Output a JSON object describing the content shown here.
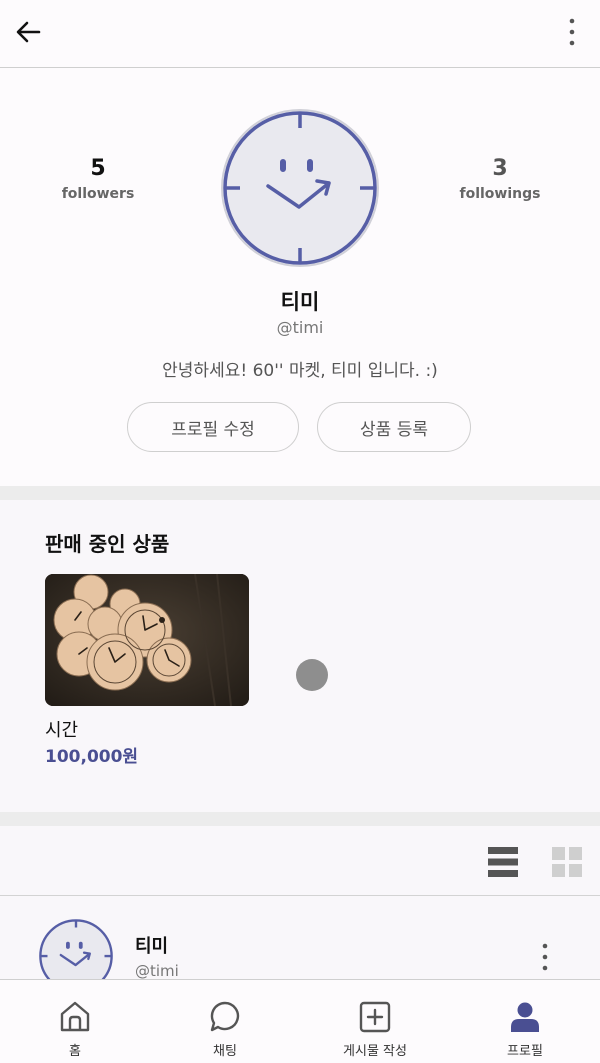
{
  "profile": {
    "followers_count": "5",
    "followers_label": "followers",
    "followings_count": "3",
    "followings_label": "followings",
    "name": "티미",
    "handle": "@timi",
    "bio": "안녕하세요! 60'' 마켓, 티미 입니다. :)",
    "edit_button": "프로필 수정",
    "add_product_button": "상품 등록"
  },
  "selling": {
    "title": "판매 중인 상품",
    "products": [
      {
        "name": "시간",
        "price": "100,000원",
        "image_icon": "pocket-watches-photo"
      }
    ]
  },
  "post": {
    "author_name": "티미",
    "author_handle": "@timi"
  },
  "tabs": [
    {
      "label": "홈",
      "icon": "home-icon"
    },
    {
      "label": "채팅",
      "icon": "chat-icon"
    },
    {
      "label": "게시물 작성",
      "icon": "plus-square-icon"
    },
    {
      "label": "프로필",
      "icon": "user-icon"
    }
  ],
  "colors": {
    "accent": "#4a4f92",
    "avatar_ring": "#565ea6",
    "avatar_fill": "#e9e9ef"
  }
}
